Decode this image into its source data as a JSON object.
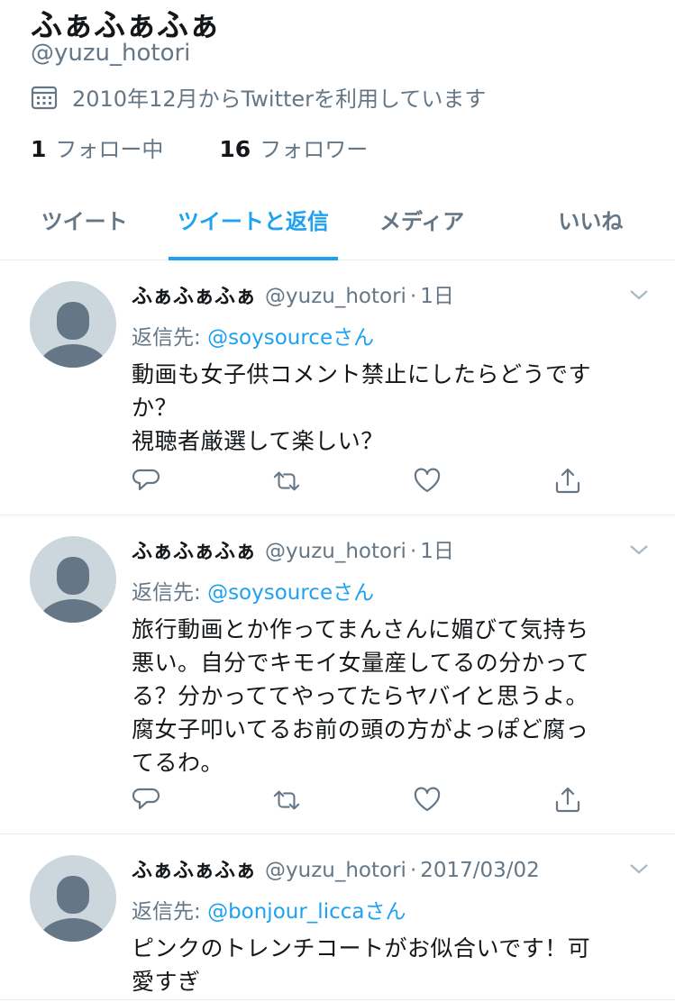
{
  "profile": {
    "display_name": "ふぁふぁふぁ",
    "handle": "@yuzu_hotori",
    "joined": "2010年12月からTwitterを利用しています",
    "following_count": "1",
    "following_label": "フォロー中",
    "followers_count": "16",
    "followers_label": "フォロワー"
  },
  "tabs": [
    {
      "label": "ツイート",
      "active": false
    },
    {
      "label": "ツイートと返信",
      "active": true
    },
    {
      "label": "メディア",
      "active": false
    },
    {
      "label": "いいね",
      "active": false
    }
  ],
  "tweets": [
    {
      "name": "ふぁふぁふぁ",
      "handle": "@yuzu_hotori",
      "dot": "·",
      "date": "1日",
      "reply_prefix": "返信先: ",
      "reply_to": "@soysourceさん",
      "text_lines": [
        "動画も女子供コメント禁止にしたらどうです",
        "か？",
        "視聴者厳選して楽しい？"
      ]
    },
    {
      "name": "ふぁふぁふぁ",
      "handle": "@yuzu_hotori",
      "dot": "·",
      "date": "1日",
      "reply_prefix": "返信先: ",
      "reply_to": "@soysourceさん",
      "text_lines": [
        "旅行動画とか作ってまんさんに媚びて気持ち",
        "悪い。自分でキモイ女量産してるの分かって",
        "る？分かっててやってたらヤバイと思うよ。",
        "腐女子叩いてるお前の頭の方がよっぽど腐っ",
        "てるわ。"
      ]
    },
    {
      "name": "ふぁふぁふぁ",
      "handle": "@yuzu_hotori",
      "dot": "·",
      "date": "2017/03/02",
      "reply_prefix": "返信先: ",
      "reply_to": "@bonjour_liccaさん",
      "text_lines": [
        "ピンクのトレンチコートがお似合いです！可",
        "愛すぎ"
      ]
    }
  ],
  "colors": {
    "accent": "#1da1f2",
    "secondary_text": "#657786",
    "primary_text": "#14171a",
    "divider": "#e6ecf0",
    "avatar_bg": "#ccd6dd",
    "avatar_fg": "#657786"
  },
  "icons": {
    "joined": "calendar-icon",
    "caret": "chevron-down-icon",
    "reply": "reply-icon",
    "retweet": "retweet-icon",
    "like": "heart-icon",
    "share": "share-icon"
  }
}
